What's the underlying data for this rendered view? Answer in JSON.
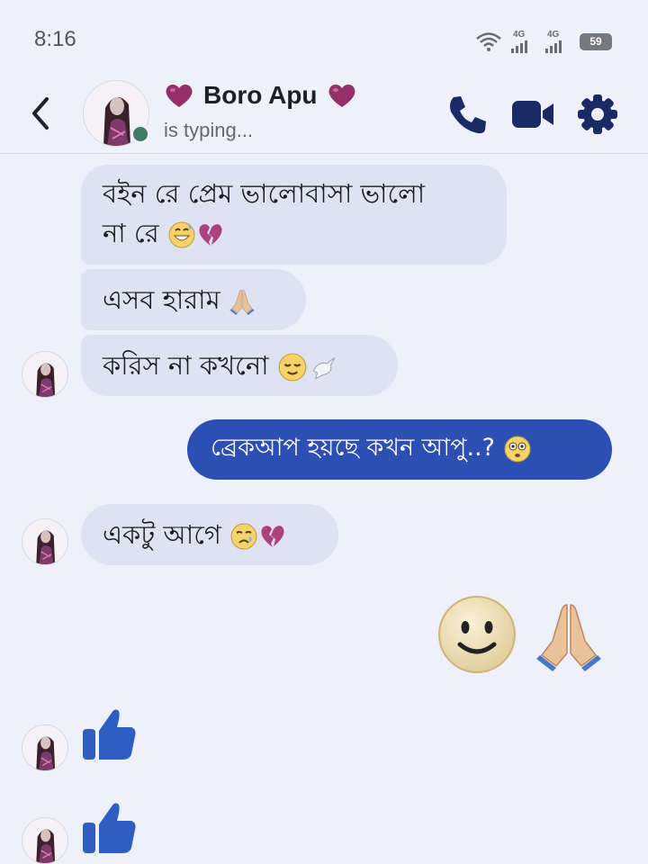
{
  "status_bar": {
    "time": "8:16",
    "network_1": "4G",
    "network_2": "4G",
    "battery": "59"
  },
  "header": {
    "contact_name": "Boro Apu",
    "status": "is typing..."
  },
  "messages": {
    "m1_line1": "বইন রে প্রেম ভালোবাসা  ভালো",
    "m1_line2": "না রে",
    "m2": "এসব হারাম",
    "m3": "করিস না কখনো",
    "m4": "ব্রেকআপ হয়ছে কখন আপু..?",
    "m5": "একটু আগে"
  },
  "icons": {
    "back": "chevron-left-icon",
    "call": "phone-icon",
    "video": "video-camera-icon",
    "settings": "gear-icon",
    "heart": "purple-heart-emoji",
    "like": "thumbs-up-icon"
  },
  "colors": {
    "background": "#eef1fb",
    "incoming_bubble": "#dfe3f1",
    "outgoing_bubble": "#2c4fb4",
    "header_icons": "#1a2a66",
    "like": "#2d5ec0"
  }
}
